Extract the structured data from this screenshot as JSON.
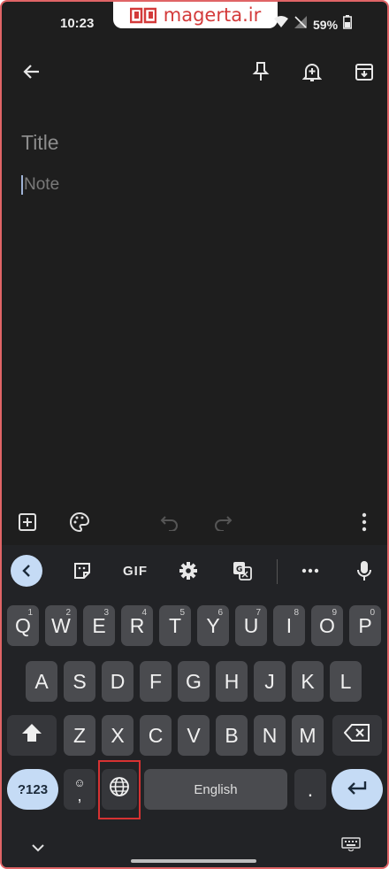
{
  "status_bar": {
    "time": "10:23",
    "battery": "59%",
    "watermark": "magerta.ir"
  },
  "app_bar": {
    "back": "arrow-back-icon",
    "pin": "pin-icon",
    "reminder": "add-reminder-icon",
    "archive": "archive-icon"
  },
  "note": {
    "title_placeholder": "Title",
    "body_placeholder": "Note"
  },
  "keyboard": {
    "toolbar": {
      "gif": "GIF"
    },
    "row1": [
      {
        "key": "Q",
        "hint": "1"
      },
      {
        "key": "W",
        "hint": "2"
      },
      {
        "key": "E",
        "hint": "3"
      },
      {
        "key": "R",
        "hint": "4"
      },
      {
        "key": "T",
        "hint": "5"
      },
      {
        "key": "Y",
        "hint": "6"
      },
      {
        "key": "U",
        "hint": "7"
      },
      {
        "key": "I",
        "hint": "8"
      },
      {
        "key": "O",
        "hint": "9"
      },
      {
        "key": "P",
        "hint": "0"
      }
    ],
    "row2": [
      "A",
      "S",
      "D",
      "F",
      "G",
      "H",
      "J",
      "K",
      "L"
    ],
    "row3": [
      "Z",
      "X",
      "C",
      "V",
      "B",
      "N",
      "M"
    ],
    "bottom": {
      "symbols": "?123",
      "emoji_comma": ",",
      "space": "English",
      "period": "."
    }
  },
  "colors": {
    "background": "#1e1e1e",
    "keyboard": "#222326",
    "key": "#4a4b4f",
    "accent": "#c5dbf5",
    "highlight": "#d63232",
    "frame": "#e06466"
  }
}
